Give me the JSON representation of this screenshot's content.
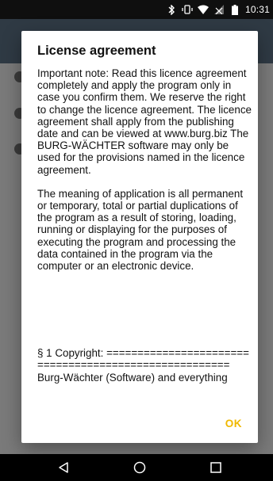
{
  "status_bar": {
    "time": "10:31",
    "icons": [
      "bluetooth-icon",
      "vibrate-icon",
      "wifi-icon",
      "signal-icon",
      "battery-icon"
    ]
  },
  "dialog": {
    "title": "License agreement",
    "paragraphs": [
      "Important note: Read this licence agreement completely and apply the program only in case you confirm them. We reserve the right to change the licence agreement. The licence agreement shall apply from the publishing date and can be viewed at www.burg.biz The BURG-WÄCHTER software may only be used for the provisions named in the licence agreement.",
      "The meaning of application is all permanent  or temporary, total or partial duplications of the program as a result of storing, loading, running or displaying for the purposes of executing the program and processing the data contained in the program via the computer or an electronic device."
    ],
    "copyright_line": "§ 1 Copyright: ======================================================",
    "cut_off_line": "Burg-Wächter (Software) and everything",
    "ok_label": "OK"
  },
  "nav_bar": {
    "icons": [
      "back-icon",
      "home-icon",
      "recents-icon"
    ]
  },
  "colors": {
    "accent": "#f0b800",
    "status_bar": "#0f0f0f",
    "scrim": "#5f5f5f"
  }
}
